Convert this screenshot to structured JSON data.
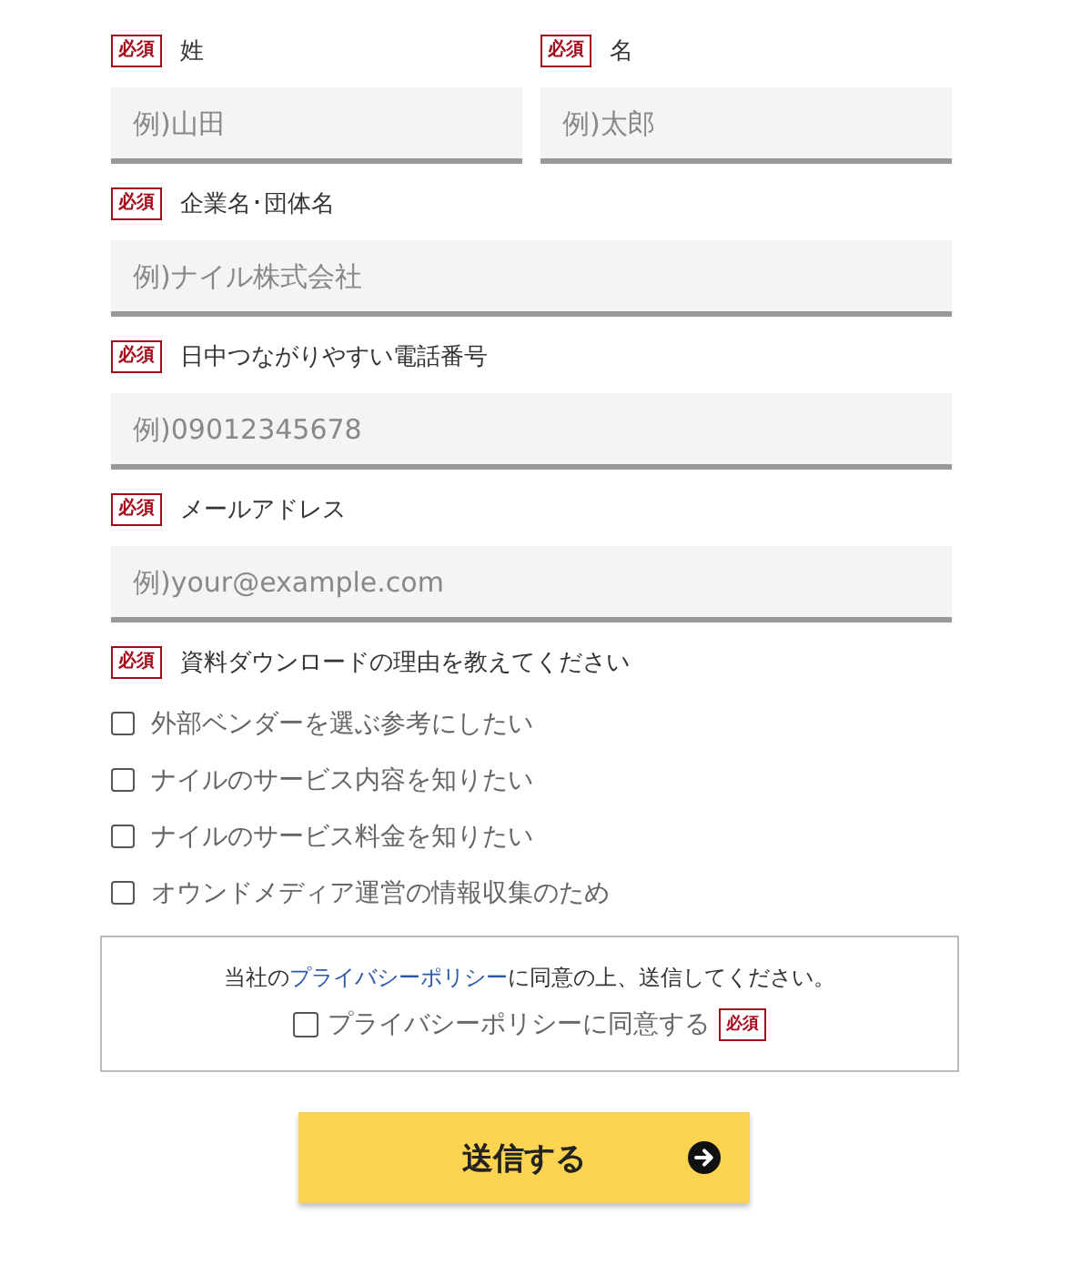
{
  "name_row": [
    {
      "label": "姓",
      "required": true,
      "badge": "必須",
      "placeholder": "例)山田"
    },
    {
      "label": "名",
      "required": true,
      "badge": "必須",
      "placeholder": "例)太郎"
    }
  ],
  "fields": [
    {
      "label": "企業名･団体名",
      "required": true,
      "badge": "必須",
      "placeholder": "例)ナイル株式会社"
    },
    {
      "label": "日中つながりやすい電話番号",
      "required": true,
      "badge": "必須",
      "placeholder": "例)09012345678"
    },
    {
      "label": "メールアドレス",
      "required": true,
      "badge": "必須",
      "placeholder": "例)your@example.com"
    }
  ],
  "reasons": {
    "label": "資料ダウンロードの理由を教えてください",
    "required": true,
    "badge": "必須",
    "options": [
      {
        "label": "外部ベンダーを選ぶ参考にしたい",
        "checked": false
      },
      {
        "label": "ナイルのサービス内容を知りたい",
        "checked": false
      },
      {
        "label": "ナイルのサービス料金を知りたい",
        "checked": false
      },
      {
        "label": "オウンドメディア運営の情報収集のため",
        "checked": false
      }
    ]
  },
  "privacy": {
    "before": "当社の",
    "link": "プライバシーポリシー",
    "after": "に同意の上、送信してください。",
    "agree_label": "プライバシーポリシーに同意する",
    "agree_checked": false,
    "required": true,
    "badge": "必須"
  },
  "submit": {
    "label": "送信する"
  }
}
